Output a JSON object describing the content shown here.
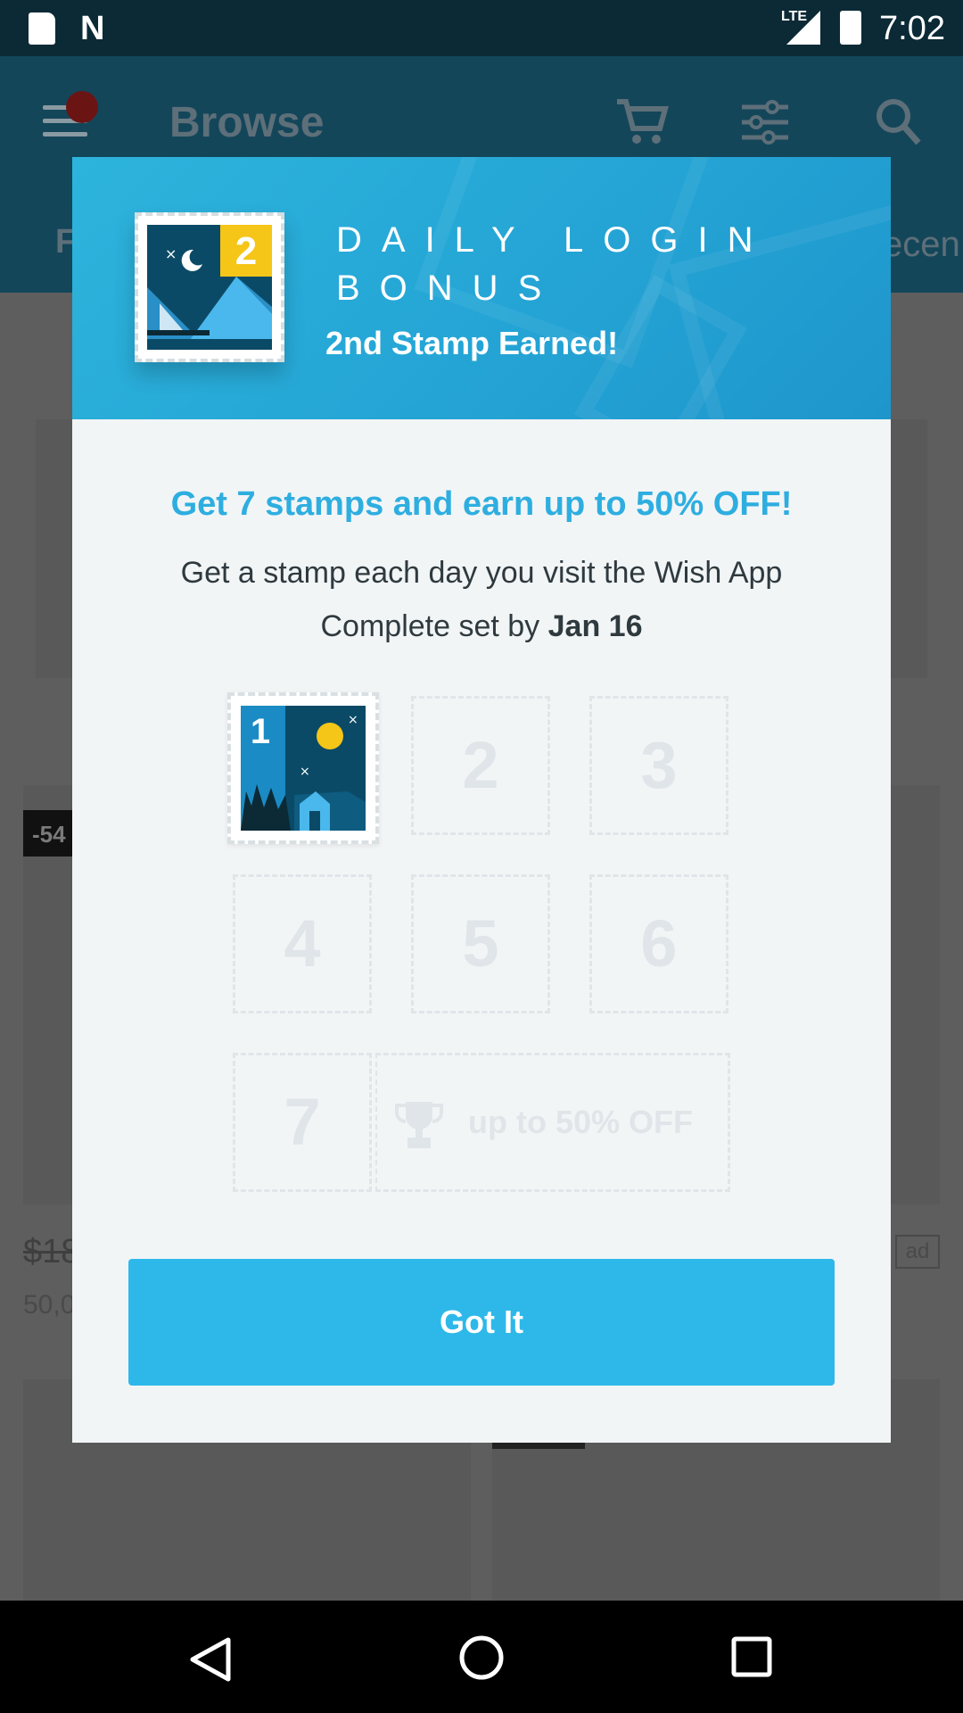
{
  "status_bar": {
    "network": "LTE",
    "time": "7:02"
  },
  "app_bar": {
    "title": "Browse",
    "tab_left_partial": "F",
    "tab_right_partial": "ecen"
  },
  "background_product": {
    "discount": "-54",
    "price": "$18",
    "count": "50,0",
    "ad_label": "ad"
  },
  "modal": {
    "header": {
      "title": "DAILY LOGIN BONUS",
      "subtitle": "2nd Stamp Earned!",
      "current_stamp_number": "2"
    },
    "headline": "Get 7 stamps and earn up to 50% OFF!",
    "description_line1": "Get a stamp each day you visit the Wish App",
    "description_line2_prefix": "Complete set by ",
    "description_line2_date": "Jan 16",
    "earned_stamp_number": "1",
    "slots": [
      "2",
      "3",
      "4",
      "5",
      "6",
      "7"
    ],
    "reward_label": "up to 50% OFF",
    "button_label": "Got It"
  },
  "colors": {
    "accent": "#2EB8EA",
    "headline": "#2EAEE0",
    "stamp_navy": "#0B4A66",
    "stamp_yellow": "#F5C518"
  },
  "icons": [
    "sd-card-icon",
    "n-icon",
    "signal-icon",
    "battery-icon",
    "menu-icon",
    "cart-icon",
    "filter-icon",
    "search-icon",
    "trophy-icon",
    "back-icon",
    "home-icon",
    "recents-icon"
  ]
}
